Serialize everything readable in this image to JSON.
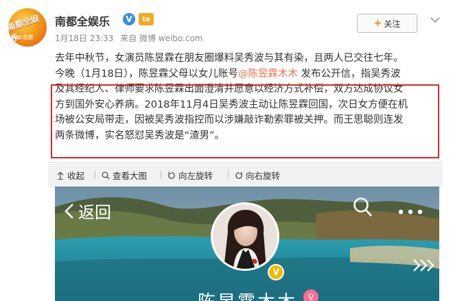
{
  "post": {
    "account_name": "南都全娱乐",
    "avatar_logo": "南都全娱乐",
    "avatar_logo_sub": "NDE南都",
    "timestamp": "1月18日 23:33",
    "source": "来自 微博 weibo.com",
    "follow_label": "关注",
    "text": {
      "line1": "去年中秋节，女演员陈昱霖在朋友圈爆料吴秀波与其有染，且两人已交往七年。",
      "line2_before": "今晚（1月18日），陈昱霖父母以女儿账号",
      "mention": "@陈昱霖木木",
      "line2_after": " 发布公开信，指吴秀波",
      "line3": "及其经纪人、律师要求陈昱霖出面澄清并愿意以经济方式补偿，双方达成协议女",
      "line4": "方到国外安心养病。2018年11月4日吴秀波主动让陈昱霖回国，次日女方便在机",
      "line5": "场被公安局带走，因被吴秀波指控而以涉嫌敲诈勒索罪被关押。而王思聪则连发",
      "line6": "两条微博，实名怒怼吴秀波是“渣男”。"
    }
  },
  "actions": {
    "collapse": "收起",
    "view_large": "查看大图",
    "rotate_left": "向左旋转",
    "rotate_right": "向右旋转"
  },
  "profile": {
    "back_label": "返回",
    "name": "陈昱霖木木",
    "gender_symbol": "♀",
    "badge_symbol": "V"
  },
  "icons": {
    "verified": "V",
    "vip": "ta"
  },
  "colors": {
    "highlight_border": "#d9262a",
    "mention": "#eb7350",
    "follow_plus": "#ff8200",
    "verified": "#3b8ce3"
  }
}
